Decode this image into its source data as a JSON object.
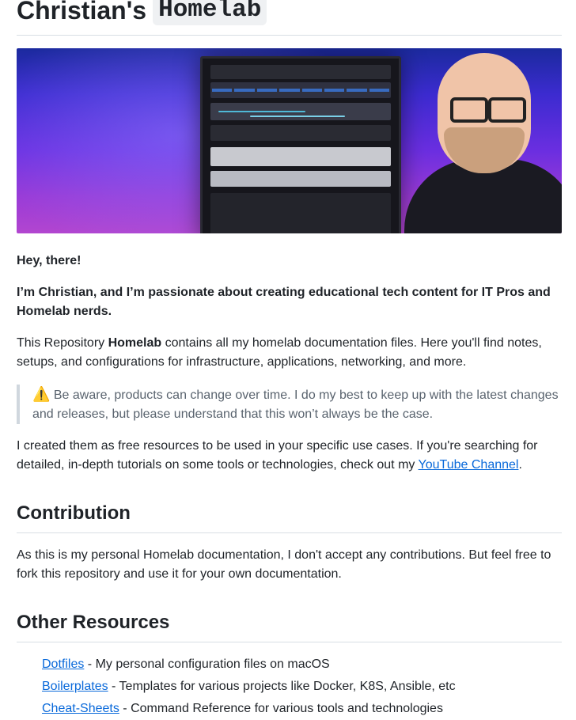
{
  "title": {
    "prefix": "Christian's",
    "code": "Homelab"
  },
  "banner": {
    "alt_label": ""
  },
  "greeting": "Hey, there!",
  "intro": "I’m Christian, and I’m passionate about creating educational tech content for IT Pros and Homelab nerds.",
  "repo_desc": {
    "before": "This Repository ",
    "strong": "Homelab",
    "after": " contains all my homelab documentation files. Here you'll find notes, setups, and configurations for infrastructure, applications, networking, and more."
  },
  "warning": {
    "icon": "⚠️",
    "text": " Be aware, products can change over time. I do my best to keep up with the latest changes and releases, but please understand that this won’t always be the case."
  },
  "resources_note": {
    "before": "I created them as free resources to be used in your specific use cases. If you're searching for detailed, in-depth tutorials on some tools or technologies, check out my ",
    "link": "YouTube Channel",
    "after": "."
  },
  "contribution": {
    "heading": "Contribution",
    "text": "As this is my personal Homelab documentation, I don't accept any contributions. But feel free to fork this repository and use it for your own documentation."
  },
  "other_resources": {
    "heading": "Other Resources",
    "items": [
      {
        "link": "Dotfiles",
        "desc": " - My personal configuration files on macOS"
      },
      {
        "link": "Boilerplates",
        "desc": " - Templates for various projects like Docker, K8S, Ansible, etc"
      },
      {
        "link": "Cheat-Sheets",
        "desc": " - Command Reference for various tools and technologies"
      }
    ]
  },
  "colors": {
    "link": "#0969da",
    "text": "#1f2328",
    "muted": "#59636e",
    "rule": "#d8dee4"
  }
}
